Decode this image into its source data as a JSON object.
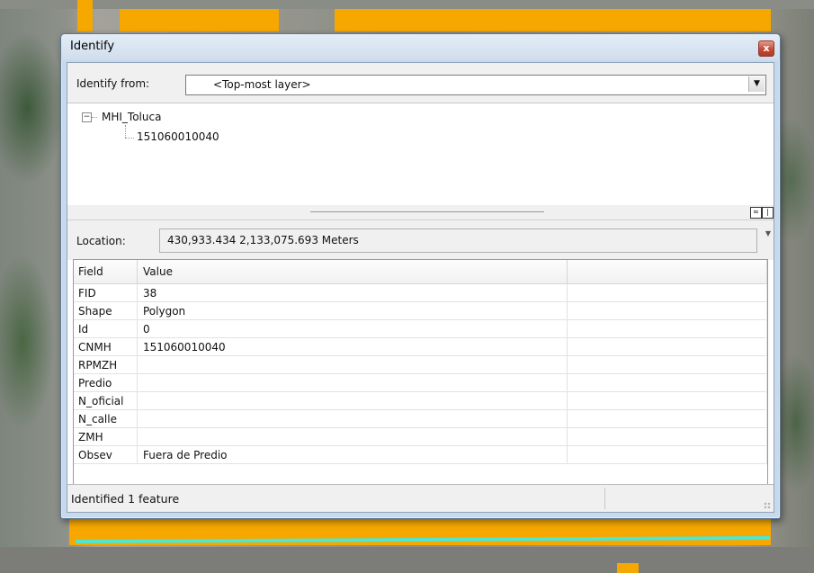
{
  "window": {
    "title": "Identify",
    "close_glyph": "x"
  },
  "identify_from": {
    "label": "Identify from:",
    "value": "<Top-most layer>",
    "arrow_icon": "chevron-down-icon"
  },
  "tree": {
    "layer": "MHI_Toluca",
    "feature": "151060010040",
    "expander": "−"
  },
  "splitter": {
    "icons": [
      "collapse-up-icon",
      "pane-toggle-icon"
    ]
  },
  "location": {
    "label": "Location:",
    "value": "430,933.434  2,133,075.693 Meters"
  },
  "attributes": {
    "columns": [
      "Field",
      "Value",
      ""
    ],
    "rows": [
      {
        "field": "FID",
        "value": "38"
      },
      {
        "field": "Shape",
        "value": "Polygon"
      },
      {
        "field": "Id",
        "value": "0"
      },
      {
        "field": "CNMH",
        "value": "151060010040"
      },
      {
        "field": "RPMZH",
        "value": ""
      },
      {
        "field": "Predio",
        "value": ""
      },
      {
        "field": "N_oficial",
        "value": ""
      },
      {
        "field": "N_calle",
        "value": ""
      },
      {
        "field": "ZMH",
        "value": ""
      },
      {
        "field": "Obsev",
        "value": "Fuera de Predio"
      }
    ]
  },
  "status": {
    "text": "Identified 1 feature"
  },
  "colors": {
    "highlight_fill": "#f6a800",
    "highlight_outline": "#4fe6d2",
    "dialog_frame": "#c9d9ec"
  }
}
